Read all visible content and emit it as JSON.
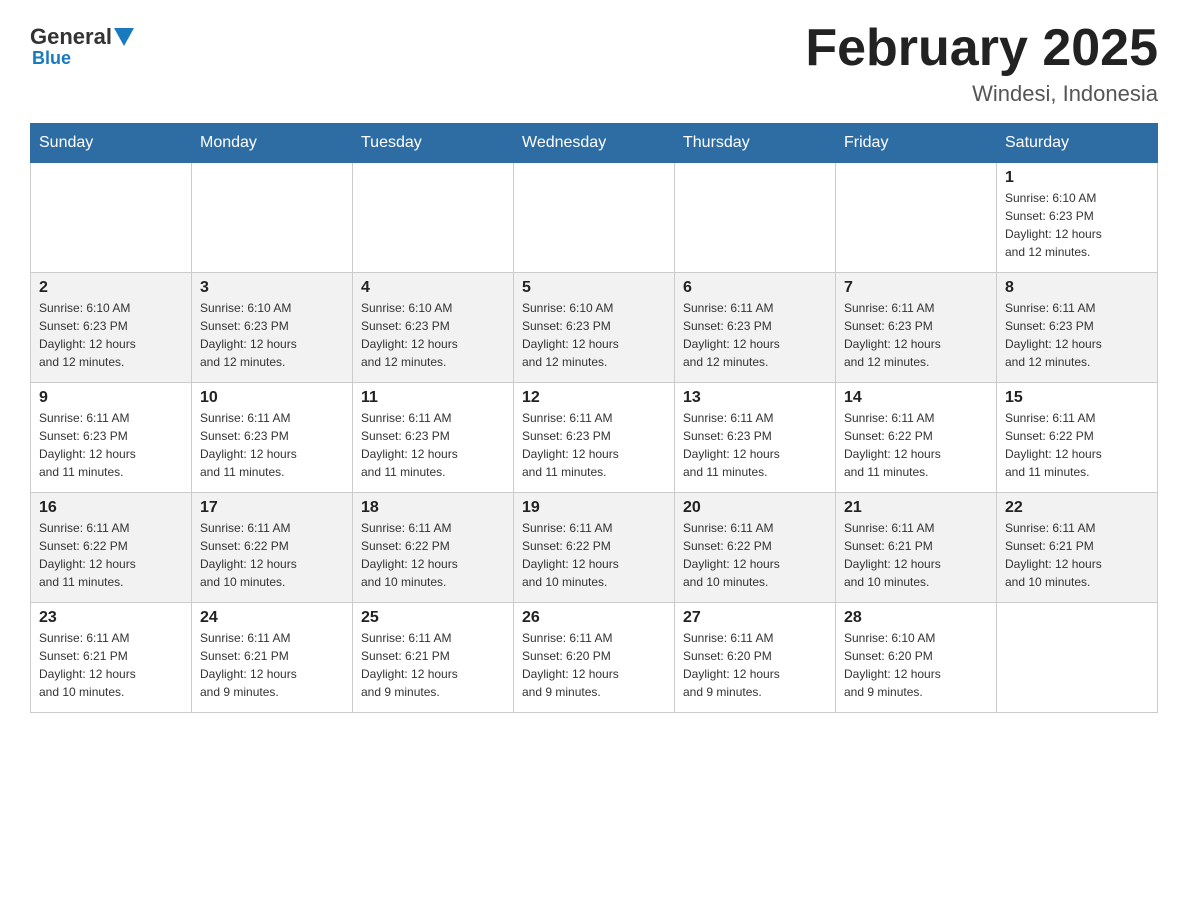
{
  "header": {
    "logo_general": "General",
    "logo_blue": "Blue",
    "month_title": "February 2025",
    "location": "Windesi, Indonesia"
  },
  "days_of_week": [
    "Sunday",
    "Monday",
    "Tuesday",
    "Wednesday",
    "Thursday",
    "Friday",
    "Saturday"
  ],
  "weeks": [
    [
      {
        "day": "",
        "info": ""
      },
      {
        "day": "",
        "info": ""
      },
      {
        "day": "",
        "info": ""
      },
      {
        "day": "",
        "info": ""
      },
      {
        "day": "",
        "info": ""
      },
      {
        "day": "",
        "info": ""
      },
      {
        "day": "1",
        "info": "Sunrise: 6:10 AM\nSunset: 6:23 PM\nDaylight: 12 hours\nand 12 minutes."
      }
    ],
    [
      {
        "day": "2",
        "info": "Sunrise: 6:10 AM\nSunset: 6:23 PM\nDaylight: 12 hours\nand 12 minutes."
      },
      {
        "day": "3",
        "info": "Sunrise: 6:10 AM\nSunset: 6:23 PM\nDaylight: 12 hours\nand 12 minutes."
      },
      {
        "day": "4",
        "info": "Sunrise: 6:10 AM\nSunset: 6:23 PM\nDaylight: 12 hours\nand 12 minutes."
      },
      {
        "day": "5",
        "info": "Sunrise: 6:10 AM\nSunset: 6:23 PM\nDaylight: 12 hours\nand 12 minutes."
      },
      {
        "day": "6",
        "info": "Sunrise: 6:11 AM\nSunset: 6:23 PM\nDaylight: 12 hours\nand 12 minutes."
      },
      {
        "day": "7",
        "info": "Sunrise: 6:11 AM\nSunset: 6:23 PM\nDaylight: 12 hours\nand 12 minutes."
      },
      {
        "day": "8",
        "info": "Sunrise: 6:11 AM\nSunset: 6:23 PM\nDaylight: 12 hours\nand 12 minutes."
      }
    ],
    [
      {
        "day": "9",
        "info": "Sunrise: 6:11 AM\nSunset: 6:23 PM\nDaylight: 12 hours\nand 11 minutes."
      },
      {
        "day": "10",
        "info": "Sunrise: 6:11 AM\nSunset: 6:23 PM\nDaylight: 12 hours\nand 11 minutes."
      },
      {
        "day": "11",
        "info": "Sunrise: 6:11 AM\nSunset: 6:23 PM\nDaylight: 12 hours\nand 11 minutes."
      },
      {
        "day": "12",
        "info": "Sunrise: 6:11 AM\nSunset: 6:23 PM\nDaylight: 12 hours\nand 11 minutes."
      },
      {
        "day": "13",
        "info": "Sunrise: 6:11 AM\nSunset: 6:23 PM\nDaylight: 12 hours\nand 11 minutes."
      },
      {
        "day": "14",
        "info": "Sunrise: 6:11 AM\nSunset: 6:22 PM\nDaylight: 12 hours\nand 11 minutes."
      },
      {
        "day": "15",
        "info": "Sunrise: 6:11 AM\nSunset: 6:22 PM\nDaylight: 12 hours\nand 11 minutes."
      }
    ],
    [
      {
        "day": "16",
        "info": "Sunrise: 6:11 AM\nSunset: 6:22 PM\nDaylight: 12 hours\nand 11 minutes."
      },
      {
        "day": "17",
        "info": "Sunrise: 6:11 AM\nSunset: 6:22 PM\nDaylight: 12 hours\nand 10 minutes."
      },
      {
        "day": "18",
        "info": "Sunrise: 6:11 AM\nSunset: 6:22 PM\nDaylight: 12 hours\nand 10 minutes."
      },
      {
        "day": "19",
        "info": "Sunrise: 6:11 AM\nSunset: 6:22 PM\nDaylight: 12 hours\nand 10 minutes."
      },
      {
        "day": "20",
        "info": "Sunrise: 6:11 AM\nSunset: 6:22 PM\nDaylight: 12 hours\nand 10 minutes."
      },
      {
        "day": "21",
        "info": "Sunrise: 6:11 AM\nSunset: 6:21 PM\nDaylight: 12 hours\nand 10 minutes."
      },
      {
        "day": "22",
        "info": "Sunrise: 6:11 AM\nSunset: 6:21 PM\nDaylight: 12 hours\nand 10 minutes."
      }
    ],
    [
      {
        "day": "23",
        "info": "Sunrise: 6:11 AM\nSunset: 6:21 PM\nDaylight: 12 hours\nand 10 minutes."
      },
      {
        "day": "24",
        "info": "Sunrise: 6:11 AM\nSunset: 6:21 PM\nDaylight: 12 hours\nand 9 minutes."
      },
      {
        "day": "25",
        "info": "Sunrise: 6:11 AM\nSunset: 6:21 PM\nDaylight: 12 hours\nand 9 minutes."
      },
      {
        "day": "26",
        "info": "Sunrise: 6:11 AM\nSunset: 6:20 PM\nDaylight: 12 hours\nand 9 minutes."
      },
      {
        "day": "27",
        "info": "Sunrise: 6:11 AM\nSunset: 6:20 PM\nDaylight: 12 hours\nand 9 minutes."
      },
      {
        "day": "28",
        "info": "Sunrise: 6:10 AM\nSunset: 6:20 PM\nDaylight: 12 hours\nand 9 minutes."
      },
      {
        "day": "",
        "info": ""
      }
    ]
  ]
}
